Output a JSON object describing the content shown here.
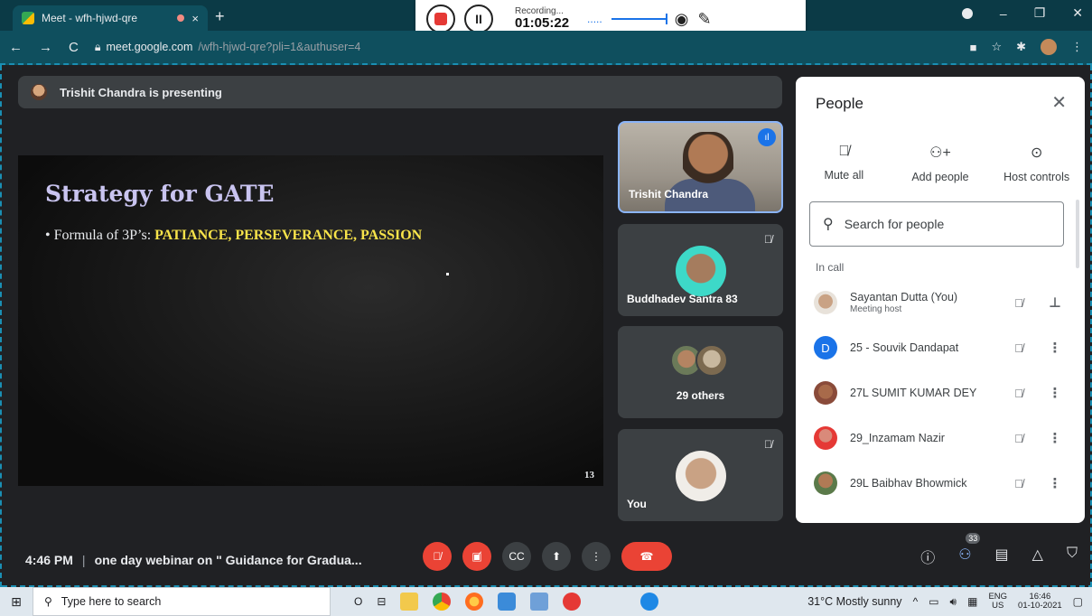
{
  "browser": {
    "tab_title": "Meet - wfh-hjwd-qre",
    "tab_close": "×",
    "new_tab": "+",
    "url_host": "meet.google.com",
    "url_path": "/wfh-hjwd-qre?pli=1&authuser=4",
    "minimize": "–",
    "restore": "❐",
    "close": "✕"
  },
  "recording": {
    "status": "Recording...",
    "elapsed": "01:05:22",
    "dots": "....."
  },
  "presenting_banner": "Trishit Chandra is presenting",
  "slide": {
    "title": "Strategy for GATE",
    "bullet_prefix": "• Formula of 3P’s: ",
    "bullet_highlight": "PATIANCE, PERSEVERANCE, PASSION",
    "page_number": "13"
  },
  "tiles": [
    {
      "name": "Trishit Chandra"
    },
    {
      "name": "Buddhadev Santra 83"
    },
    {
      "name": "29 others"
    },
    {
      "name": "You"
    }
  ],
  "people_panel": {
    "title": "People",
    "actions": {
      "mute_all": "Mute all",
      "add_people": "Add people",
      "host_controls": "Host controls"
    },
    "search_placeholder": "Search for people",
    "section": "In call",
    "participants": [
      {
        "name": "Sayantan Dutta (You)",
        "sub": "Meeting host"
      },
      {
        "name": "25 - Souvik Dandapat",
        "initial": "D"
      },
      {
        "name": "27L SUMIT KUMAR DEY"
      },
      {
        "name": "29_Inzamam Nazir"
      },
      {
        "name": "29L Baibhav Bhowmick"
      }
    ]
  },
  "bottom_bar": {
    "time": "4:46 PM",
    "separator": "|",
    "meeting_title": "one day webinar on \" Guidance for Gradua...",
    "participant_count": "33"
  },
  "taskbar": {
    "search_placeholder": "Type here to search",
    "weather": "31°C  Mostly sunny",
    "lang_line1": "ENG",
    "lang_line2": "US",
    "clock_time": "16:46",
    "clock_date": "01-10-2021"
  }
}
